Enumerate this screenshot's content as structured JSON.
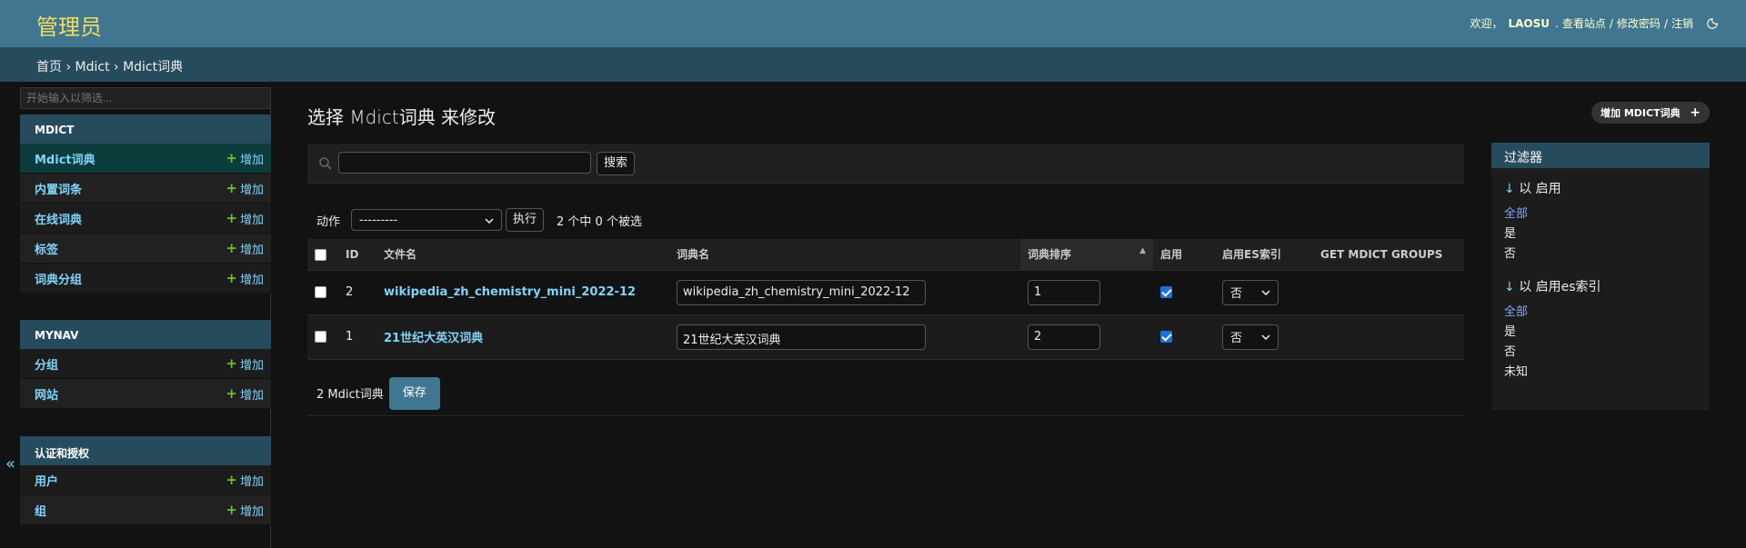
{
  "header": {
    "brand": "管理员",
    "welcome": "欢迎，",
    "username": "LAOSU",
    "view_site": "查看站点",
    "change_password": "修改密码",
    "logout": "注销",
    "sep": "/"
  },
  "breadcrumbs": {
    "home": "首页",
    "app": "Mdict",
    "model": "Mdict词典",
    "sep": "›"
  },
  "sidebar": {
    "filter_placeholder": "开始输入以筛选...",
    "add_label": "增加",
    "modules": [
      {
        "caption": "MDICT",
        "items": [
          "Mdict词典",
          "内置词条",
          "在线词典",
          "标签",
          "词典分组"
        ]
      },
      {
        "caption": "MYNAV",
        "items": [
          "分组",
          "网站"
        ]
      },
      {
        "caption": "认证和授权",
        "items": [
          "用户",
          "组"
        ]
      }
    ],
    "collapse": "«"
  },
  "page": {
    "title": "选择 Mdict词典 来修改",
    "add_button": "增加 MDICT词典"
  },
  "search": {
    "button": "搜索",
    "value": ""
  },
  "actions": {
    "label": "动作",
    "selected": "---------",
    "run": "执行",
    "counter": "2 个中 0 个被选"
  },
  "table": {
    "headers": [
      "ID",
      "文件名",
      "词典名",
      "词典排序",
      "启用",
      "启用ES索引",
      "GET MDICT GROUPS"
    ],
    "rows": [
      {
        "id": "2",
        "file": "wikipedia_zh_chemistry_mini_2022-12",
        "name": "wikipedia_zh_chemistry_mini_2022-12",
        "order": "1",
        "enabled": true,
        "es": "否"
      },
      {
        "id": "1",
        "file": "21世纪大英汉词典",
        "name": "21世纪大英汉词典",
        "order": "2",
        "enabled": true,
        "es": "否"
      }
    ]
  },
  "footer": {
    "count": "2 Mdict词典",
    "save": "保存"
  },
  "filter": {
    "title": "过滤器",
    "groups": [
      {
        "heading": "以 启用",
        "options": [
          "全部",
          "是",
          "否"
        ],
        "selected": 0
      },
      {
        "heading": "以 启用es索引",
        "options": [
          "全部",
          "是",
          "否",
          "未知"
        ],
        "selected": 0
      }
    ]
  },
  "colors": {
    "header": "#417690",
    "breadcrumbs": "#264b5d",
    "brand": "#f5dd5d",
    "link": "#81d4fa",
    "add_plus": "#70bf2b",
    "background": "#121212"
  }
}
